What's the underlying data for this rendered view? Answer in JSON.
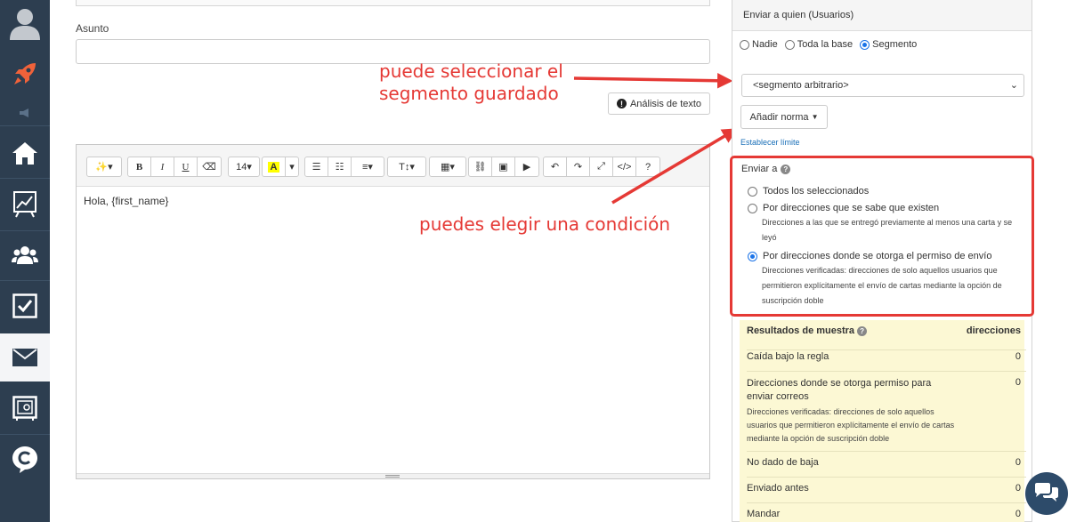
{
  "main": {
    "subject_label": "Asunto",
    "subject_value": "",
    "text_analysis_label": "Análisis de texto",
    "editor_body": "Hola, {first_name}",
    "font_size": "14"
  },
  "annotations": {
    "segment_line1": "puede seleccionar el",
    "segment_line2": "segmento guardado",
    "condition": "puedes elegir una condición"
  },
  "panel": {
    "header": "Enviar a quien (Usuarios)",
    "radio": {
      "none": "Nadie",
      "all": "Toda la base",
      "segment": "Segmento",
      "selected": "segment"
    },
    "segment_select": "<segmento arbitrario>",
    "add_rule_label": "Añadir norma",
    "set_limit_link": "Establecer límite",
    "send_to": {
      "title": "Enviar a",
      "selected": "permission",
      "options": [
        {
          "label": "Todos los seleccionados",
          "desc": ""
        },
        {
          "label": "Por direcciones que se sabe que existen",
          "desc": "Direcciones a las que se entregó previamente al menos una carta y se leyó"
        },
        {
          "label": "Por direcciones donde se otorga el permiso de envío",
          "desc": "Direcciones verificadas: direcciones de solo aquellos usuarios que permitieron explícitamente el envío de cartas mediante la opción de suscripción doble"
        }
      ]
    },
    "results": {
      "title": "Resultados de muestra",
      "column": "direcciones",
      "rows": [
        {
          "label": "Caída bajo la regla",
          "sub": "",
          "value": "0"
        },
        {
          "label": "Direcciones donde se otorga permiso para enviar correos",
          "sub": "Direcciones verificadas: direcciones de solo aquellos usuarios que permitieron explícitamente el envío de cartas mediante la opción de suscripción doble",
          "value": "0"
        },
        {
          "label": "No dado de baja",
          "sub": "",
          "value": "0"
        },
        {
          "label": "Enviado antes",
          "sub": "",
          "value": "0"
        },
        {
          "label": "Mandar",
          "sub": "",
          "value": "0"
        }
      ]
    }
  },
  "colors": {
    "sidebar": "#2d3e50",
    "annotation": "#e53935",
    "accent": "#1a73e8",
    "results_bg": "#fcf8d4",
    "rocket": "#f0623a"
  }
}
